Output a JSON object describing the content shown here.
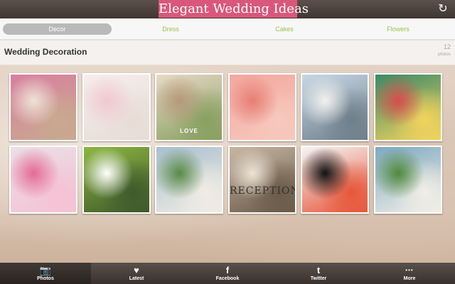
{
  "app": {
    "title": "Elegant Wedding Ideas",
    "refresh_icon": "refresh-icon"
  },
  "tabs": [
    {
      "label": "Decor",
      "active": true
    },
    {
      "label": "Dress",
      "active": false
    },
    {
      "label": "Cakes",
      "active": false
    },
    {
      "label": "Flowers",
      "active": false
    }
  ],
  "section": {
    "title": "Wedding Decoration",
    "count": "12",
    "count_unit": "photos"
  },
  "thumbnails": [
    {
      "subject": "pink flower brooch and birdcage",
      "colors": [
        "#d87fa0",
        "#efe3d8",
        "#c9a98f"
      ]
    },
    {
      "subject": "white wedding aisle with floral centerpiece",
      "colors": [
        "#f4eeec",
        "#f2c7d0",
        "#e8dcd6"
      ]
    },
    {
      "subject": "wooden heart and cupcake with LOVE sign",
      "colors": [
        "#e8d9c6",
        "#b69879",
        "#88a060"
      ],
      "overlay_text": "LOVE"
    },
    {
      "subject": "pink draped reception hall",
      "colors": [
        "#f2a8a0",
        "#e77e73",
        "#f7c8bd"
      ]
    },
    {
      "subject": "chandelier over outdoor tent reception",
      "colors": [
        "#c7d7e6",
        "#f2f1ee",
        "#6f7f8a"
      ]
    },
    {
      "subject": "colorful tented reception",
      "colors": [
        "#3a8a68",
        "#d94c4c",
        "#f2d35d"
      ]
    },
    {
      "subject": "pink rose centerpiece",
      "colors": [
        "#eadfe6",
        "#e46a93",
        "#f5c2d4"
      ]
    },
    {
      "subject": "green table settings with candles",
      "colors": [
        "#8cb640",
        "#ffffff",
        "#3f5a2c"
      ]
    },
    {
      "subject": "outdoor wedding arbor",
      "colors": [
        "#a9c0cf",
        "#5a8a48",
        "#f0ece4"
      ]
    },
    {
      "subject": "Reception wooden sign",
      "colors": [
        "#c7b6a2",
        "#ede4d7",
        "#6a5a48"
      ],
      "overlay_text": "RECEPTION"
    },
    {
      "subject": "striped table with colorful flowers",
      "colors": [
        "#f5f5f5",
        "#111111",
        "#e6573a"
      ]
    },
    {
      "subject": "lakeside wedding arch",
      "colors": [
        "#7ea9c2",
        "#4f8a3a",
        "#f1eee5"
      ]
    }
  ],
  "bottom_nav": [
    {
      "label": "Photos",
      "icon": "camera-icon",
      "glyph": "📷",
      "active": true
    },
    {
      "label": "Latest",
      "icon": "heart-icon",
      "glyph": "♥",
      "active": false
    },
    {
      "label": "Facebook",
      "icon": "facebook-icon",
      "glyph": "f",
      "active": false
    },
    {
      "label": "Twitter",
      "icon": "twitter-icon",
      "glyph": "t",
      "active": false
    },
    {
      "label": "More",
      "icon": "more-icon",
      "glyph": "•••",
      "active": false
    }
  ]
}
